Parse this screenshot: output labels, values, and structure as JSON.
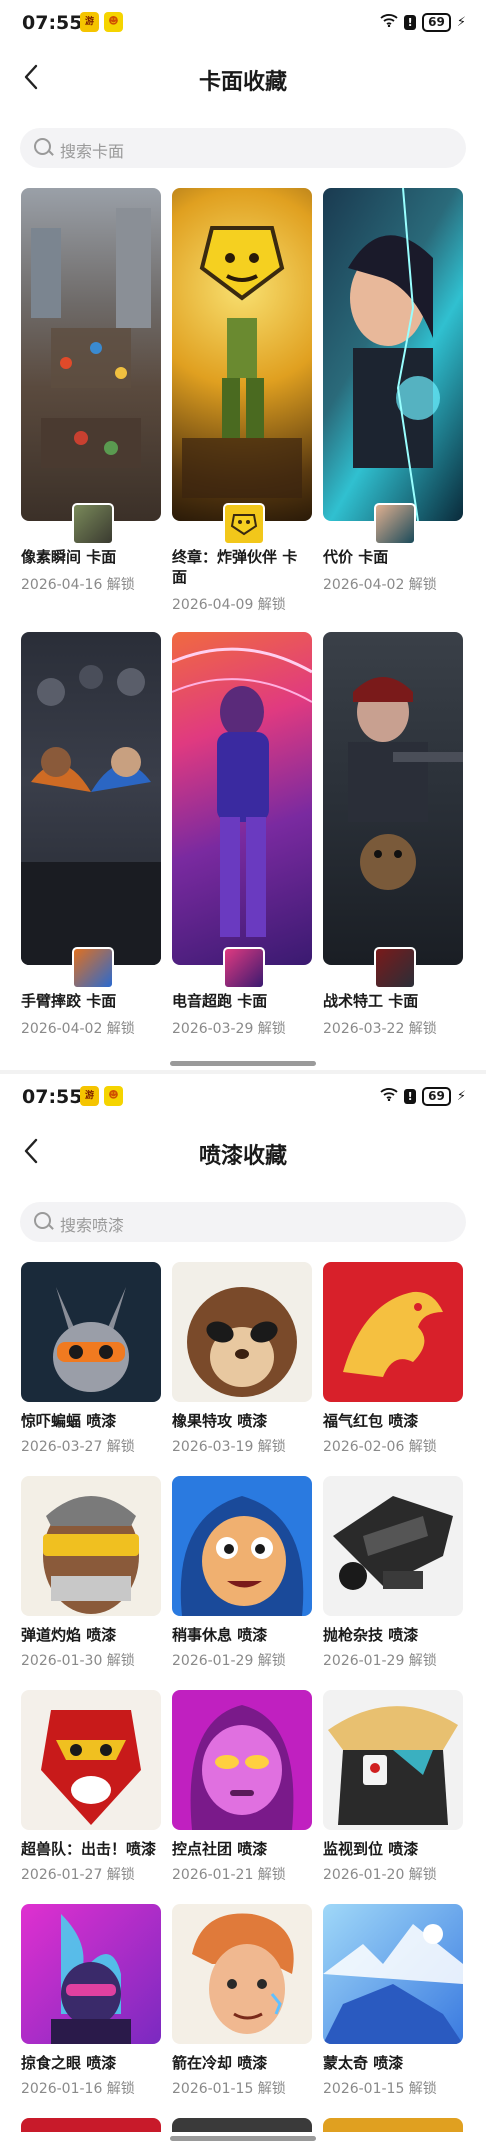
{
  "status": {
    "time": "07:55",
    "battery": "69"
  },
  "screen1": {
    "title": "卡面收藏",
    "search_placeholder": "搜索卡面",
    "cards": [
      {
        "name": "像素瞬间 卡面",
        "date": "2026-04-16 解锁"
      },
      {
        "name": "终章：炸弹伙伴 卡面",
        "date": "2026-04-09 解锁"
      },
      {
        "name": "代价 卡面",
        "date": "2026-04-02 解锁"
      },
      {
        "name": "手臂摔跤 卡面",
        "date": "2026-04-02 解锁"
      },
      {
        "name": "电音超跑 卡面",
        "date": "2026-03-29 解锁"
      },
      {
        "name": "战术特工 卡面",
        "date": "2026-03-22 解锁"
      }
    ]
  },
  "screen2": {
    "title": "喷漆收藏",
    "search_placeholder": "搜索喷漆",
    "sprays": [
      {
        "name": "惊吓蝙蝠 喷漆",
        "date": "2026-03-27 解锁"
      },
      {
        "name": "橡果特攻 喷漆",
        "date": "2026-03-19 解锁"
      },
      {
        "name": "福气红包 喷漆",
        "date": "2026-02-06 解锁"
      },
      {
        "name": "弹道灼焰 喷漆",
        "date": "2026-01-30 解锁"
      },
      {
        "name": "稍事休息 喷漆",
        "date": "2026-01-29 解锁"
      },
      {
        "name": "抛枪杂技 喷漆",
        "date": "2026-01-29 解锁"
      },
      {
        "name": "超兽队：出击！喷漆",
        "date": "2026-01-27 解锁"
      },
      {
        "name": "控点社团 喷漆",
        "date": "2026-01-21 解锁"
      },
      {
        "name": "监视到位 喷漆",
        "date": "2026-01-20 解锁"
      },
      {
        "name": "掠食之眼 喷漆",
        "date": "2026-01-16 解锁"
      },
      {
        "name": "箭在冷却 喷漆",
        "date": "2026-01-15 解锁"
      },
      {
        "name": "蒙太奇 喷漆",
        "date": "2026-01-15 解锁"
      }
    ]
  },
  "icons": {
    "back": "chevron-left-icon",
    "search": "search-icon",
    "wifi": "wifi-icon",
    "alert": "alert-icon",
    "charging": "bolt-icon"
  }
}
